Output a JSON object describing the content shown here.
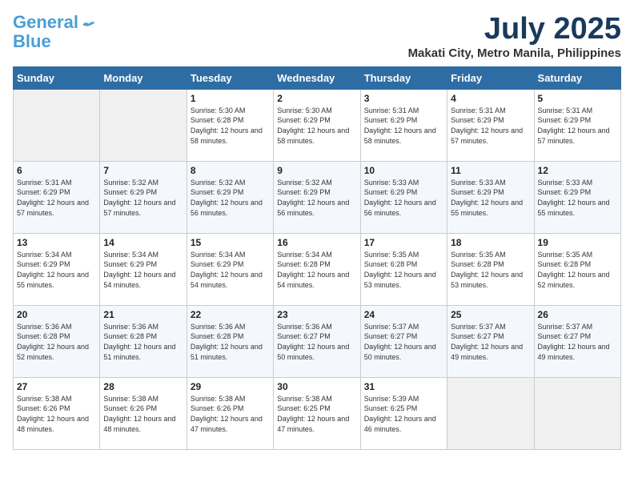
{
  "header": {
    "logo_line1": "General",
    "logo_line2": "Blue",
    "month_year": "July 2025",
    "location": "Makati City, Metro Manila, Philippines"
  },
  "days_of_week": [
    "Sunday",
    "Monday",
    "Tuesday",
    "Wednesday",
    "Thursday",
    "Friday",
    "Saturday"
  ],
  "weeks": [
    [
      {
        "day": "",
        "sunrise": "",
        "sunset": "",
        "daylight": ""
      },
      {
        "day": "",
        "sunrise": "",
        "sunset": "",
        "daylight": ""
      },
      {
        "day": "1",
        "sunrise": "Sunrise: 5:30 AM",
        "sunset": "Sunset: 6:28 PM",
        "daylight": "Daylight: 12 hours and 58 minutes."
      },
      {
        "day": "2",
        "sunrise": "Sunrise: 5:30 AM",
        "sunset": "Sunset: 6:29 PM",
        "daylight": "Daylight: 12 hours and 58 minutes."
      },
      {
        "day": "3",
        "sunrise": "Sunrise: 5:31 AM",
        "sunset": "Sunset: 6:29 PM",
        "daylight": "Daylight: 12 hours and 58 minutes."
      },
      {
        "day": "4",
        "sunrise": "Sunrise: 5:31 AM",
        "sunset": "Sunset: 6:29 PM",
        "daylight": "Daylight: 12 hours and 57 minutes."
      },
      {
        "day": "5",
        "sunrise": "Sunrise: 5:31 AM",
        "sunset": "Sunset: 6:29 PM",
        "daylight": "Daylight: 12 hours and 57 minutes."
      }
    ],
    [
      {
        "day": "6",
        "sunrise": "Sunrise: 5:31 AM",
        "sunset": "Sunset: 6:29 PM",
        "daylight": "Daylight: 12 hours and 57 minutes."
      },
      {
        "day": "7",
        "sunrise": "Sunrise: 5:32 AM",
        "sunset": "Sunset: 6:29 PM",
        "daylight": "Daylight: 12 hours and 57 minutes."
      },
      {
        "day": "8",
        "sunrise": "Sunrise: 5:32 AM",
        "sunset": "Sunset: 6:29 PM",
        "daylight": "Daylight: 12 hours and 56 minutes."
      },
      {
        "day": "9",
        "sunrise": "Sunrise: 5:32 AM",
        "sunset": "Sunset: 6:29 PM",
        "daylight": "Daylight: 12 hours and 56 minutes."
      },
      {
        "day": "10",
        "sunrise": "Sunrise: 5:33 AM",
        "sunset": "Sunset: 6:29 PM",
        "daylight": "Daylight: 12 hours and 56 minutes."
      },
      {
        "day": "11",
        "sunrise": "Sunrise: 5:33 AM",
        "sunset": "Sunset: 6:29 PM",
        "daylight": "Daylight: 12 hours and 55 minutes."
      },
      {
        "day": "12",
        "sunrise": "Sunrise: 5:33 AM",
        "sunset": "Sunset: 6:29 PM",
        "daylight": "Daylight: 12 hours and 55 minutes."
      }
    ],
    [
      {
        "day": "13",
        "sunrise": "Sunrise: 5:34 AM",
        "sunset": "Sunset: 6:29 PM",
        "daylight": "Daylight: 12 hours and 55 minutes."
      },
      {
        "day": "14",
        "sunrise": "Sunrise: 5:34 AM",
        "sunset": "Sunset: 6:29 PM",
        "daylight": "Daylight: 12 hours and 54 minutes."
      },
      {
        "day": "15",
        "sunrise": "Sunrise: 5:34 AM",
        "sunset": "Sunset: 6:29 PM",
        "daylight": "Daylight: 12 hours and 54 minutes."
      },
      {
        "day": "16",
        "sunrise": "Sunrise: 5:34 AM",
        "sunset": "Sunset: 6:28 PM",
        "daylight": "Daylight: 12 hours and 54 minutes."
      },
      {
        "day": "17",
        "sunrise": "Sunrise: 5:35 AM",
        "sunset": "Sunset: 6:28 PM",
        "daylight": "Daylight: 12 hours and 53 minutes."
      },
      {
        "day": "18",
        "sunrise": "Sunrise: 5:35 AM",
        "sunset": "Sunset: 6:28 PM",
        "daylight": "Daylight: 12 hours and 53 minutes."
      },
      {
        "day": "19",
        "sunrise": "Sunrise: 5:35 AM",
        "sunset": "Sunset: 6:28 PM",
        "daylight": "Daylight: 12 hours and 52 minutes."
      }
    ],
    [
      {
        "day": "20",
        "sunrise": "Sunrise: 5:36 AM",
        "sunset": "Sunset: 6:28 PM",
        "daylight": "Daylight: 12 hours and 52 minutes."
      },
      {
        "day": "21",
        "sunrise": "Sunrise: 5:36 AM",
        "sunset": "Sunset: 6:28 PM",
        "daylight": "Daylight: 12 hours and 51 minutes."
      },
      {
        "day": "22",
        "sunrise": "Sunrise: 5:36 AM",
        "sunset": "Sunset: 6:28 PM",
        "daylight": "Daylight: 12 hours and 51 minutes."
      },
      {
        "day": "23",
        "sunrise": "Sunrise: 5:36 AM",
        "sunset": "Sunset: 6:27 PM",
        "daylight": "Daylight: 12 hours and 50 minutes."
      },
      {
        "day": "24",
        "sunrise": "Sunrise: 5:37 AM",
        "sunset": "Sunset: 6:27 PM",
        "daylight": "Daylight: 12 hours and 50 minutes."
      },
      {
        "day": "25",
        "sunrise": "Sunrise: 5:37 AM",
        "sunset": "Sunset: 6:27 PM",
        "daylight": "Daylight: 12 hours and 49 minutes."
      },
      {
        "day": "26",
        "sunrise": "Sunrise: 5:37 AM",
        "sunset": "Sunset: 6:27 PM",
        "daylight": "Daylight: 12 hours and 49 minutes."
      }
    ],
    [
      {
        "day": "27",
        "sunrise": "Sunrise: 5:38 AM",
        "sunset": "Sunset: 6:26 PM",
        "daylight": "Daylight: 12 hours and 48 minutes."
      },
      {
        "day": "28",
        "sunrise": "Sunrise: 5:38 AM",
        "sunset": "Sunset: 6:26 PM",
        "daylight": "Daylight: 12 hours and 48 minutes."
      },
      {
        "day": "29",
        "sunrise": "Sunrise: 5:38 AM",
        "sunset": "Sunset: 6:26 PM",
        "daylight": "Daylight: 12 hours and 47 minutes."
      },
      {
        "day": "30",
        "sunrise": "Sunrise: 5:38 AM",
        "sunset": "Sunset: 6:25 PM",
        "daylight": "Daylight: 12 hours and 47 minutes."
      },
      {
        "day": "31",
        "sunrise": "Sunrise: 5:39 AM",
        "sunset": "Sunset: 6:25 PM",
        "daylight": "Daylight: 12 hours and 46 minutes."
      },
      {
        "day": "",
        "sunrise": "",
        "sunset": "",
        "daylight": ""
      },
      {
        "day": "",
        "sunrise": "",
        "sunset": "",
        "daylight": ""
      }
    ]
  ]
}
